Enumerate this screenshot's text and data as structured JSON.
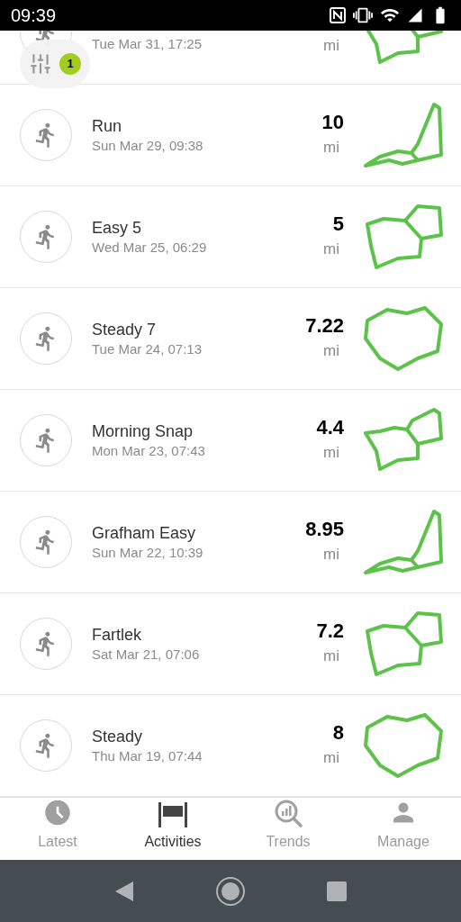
{
  "status_bar": {
    "time": "09:39"
  },
  "filter": {
    "badge": "1"
  },
  "activities": [
    {
      "date": "Tue Mar 31, 17:25",
      "unit": "mi"
    },
    {
      "title": "Run",
      "date": "Sun Mar 29, 09:38",
      "distance": "10",
      "unit": "mi"
    },
    {
      "title": "Easy 5",
      "date": "Wed Mar 25, 06:29",
      "distance": "5",
      "unit": "mi"
    },
    {
      "title": "Steady 7",
      "date": "Tue Mar 24, 07:13",
      "distance": "7.22",
      "unit": "mi"
    },
    {
      "title": "Morning Snap",
      "date": "Mon Mar 23, 07:43",
      "distance": "4.4",
      "unit": "mi"
    },
    {
      "title": "Grafham Easy",
      "date": "Sun Mar 22, 10:39",
      "distance": "8.95",
      "unit": "mi"
    },
    {
      "title": "Fartlek",
      "date": "Sat Mar 21, 07:06",
      "distance": "7.2",
      "unit": "mi"
    },
    {
      "title": "Steady",
      "date": "Thu Mar 19, 07:44",
      "distance": "8",
      "unit": "mi"
    }
  ],
  "tabs": [
    {
      "kind": "latest",
      "label": "Latest",
      "selected": false
    },
    {
      "kind": "activities",
      "label": "Activities",
      "selected": true
    },
    {
      "kind": "trends",
      "label": "Trends",
      "selected": false
    },
    {
      "kind": "manage",
      "label": "Manage",
      "selected": false
    }
  ]
}
